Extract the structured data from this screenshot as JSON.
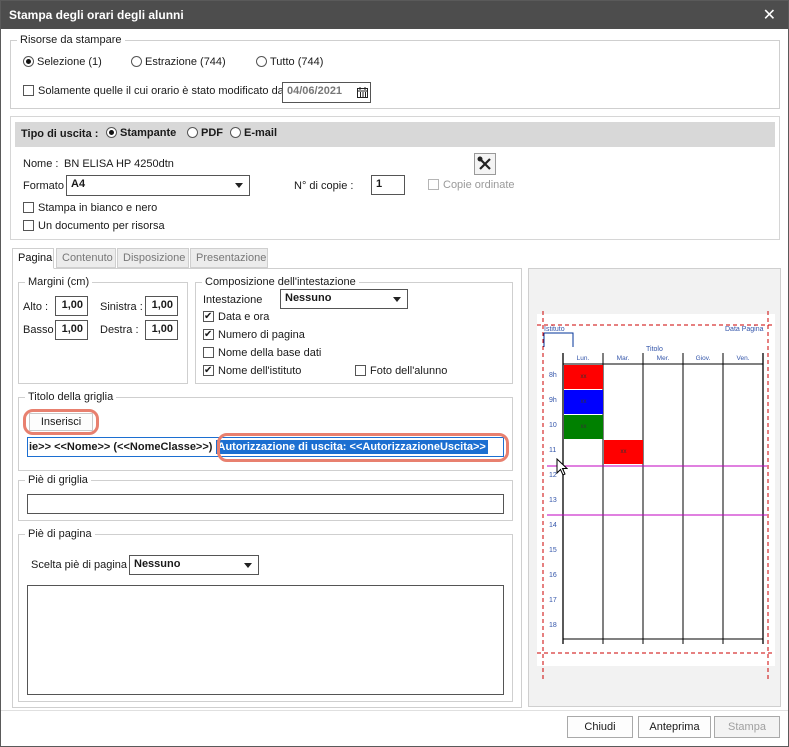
{
  "window": {
    "title": "Stampa degli orari degli alunni"
  },
  "risorse": {
    "legend": "Risorse da stampare",
    "options": [
      "Selezione (1)",
      "Estrazione (744)",
      "Tutto (744)"
    ],
    "selected": 0,
    "modified_label": "Solamente quelle il cui orario è stato modificato dal",
    "modified_date": "04/06/2021"
  },
  "output": {
    "label": "Tipo di uscita :",
    "options": [
      "Stampante",
      "PDF",
      "E-mail"
    ],
    "selected": 0,
    "nome_label": "Nome :",
    "nome_value": "BN ELISA HP 4250dtn",
    "formato_label": "Formato",
    "formato_value": "A4",
    "copie_label": "N° di copie :",
    "copie_value": "1",
    "copie_ordinate": "Copie ordinate",
    "bianco_nero": "Stampa in bianco e nero",
    "un_documento": "Un documento per risorsa"
  },
  "tabs": [
    "Pagina",
    "Contenuto",
    "Disposizione",
    "Presentazione"
  ],
  "margini": {
    "legend": "Margini (cm)",
    "alto_label": "Alto :",
    "alto": "1,00",
    "sinistra_label": "Sinistra :",
    "sinistra": "1,00",
    "basso_label": "Basso",
    "basso": "1,00",
    "destra_label": "Destra :",
    "destra": "1,00"
  },
  "intestazione": {
    "legend": "Composizione dell'intestazione",
    "label": "Intestazione",
    "value": "Nessuno",
    "checks": [
      {
        "label": "Data e ora",
        "checked": true
      },
      {
        "label": "Numero di pagina",
        "checked": true
      },
      {
        "label": "Nome della base dati",
        "checked": false
      },
      {
        "label": "Nome dell'istituto",
        "checked": true
      }
    ],
    "foto": {
      "label": "Foto dell'alunno",
      "checked": false
    }
  },
  "titolo": {
    "legend": "Titolo della griglia",
    "inserisci": "Inserisci",
    "text_plain": "ie>> <<Nome>> (<<NomeClasse>>) ",
    "text_selected": "Autorizzazione di uscita: <<AutorizzazioneUscita>>"
  },
  "pie_griglia": {
    "legend": "Piè di griglia",
    "value": ""
  },
  "pie_pagina": {
    "legend": "Piè di pagina",
    "scelta_label": "Scelta piè di pagina",
    "scelta_value": "Nessuno",
    "value": ""
  },
  "preview": {
    "istituto": "Istituto",
    "data_pagina": "Data Pagina",
    "titolo": "Titolo",
    "days": [
      "Lun.",
      "Mar.",
      "Mer.",
      "Giov.",
      "Ven."
    ],
    "hours": [
      "8h",
      "9h",
      "10",
      "11",
      "12",
      "13",
      "14",
      "15",
      "16",
      "17",
      "18"
    ],
    "cell_label": "xx",
    "cells": [
      {
        "day": 0,
        "hour": 0,
        "color": "#ff0000"
      },
      {
        "day": 0,
        "hour": 1,
        "color": "#0000ff"
      },
      {
        "day": 0,
        "hour": 2,
        "color": "#008000"
      },
      {
        "day": 1,
        "hour": 3,
        "color": "#ff0000"
      }
    ]
  },
  "buttons": {
    "chiudi": "Chiudi",
    "anteprima": "Anteprima",
    "stampa": "Stampa"
  },
  "colors": {
    "titlebar": "#4d4d4d",
    "accent_ring": "#e8806f",
    "selection": "#1c6fd1"
  }
}
